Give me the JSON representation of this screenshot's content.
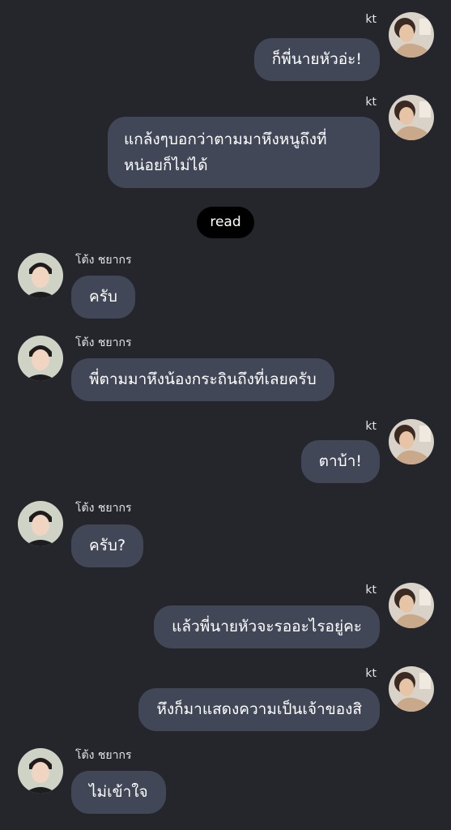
{
  "theme": {
    "background": "#24262c",
    "bubble": "#414756",
    "bubble_text": "#ffffff",
    "read_pill": "#000000"
  },
  "read_receipt": "read",
  "messages": [
    {
      "id": 1,
      "sender": "kt",
      "side": "right",
      "avatar_icon": "kt-avatar-icon",
      "text": "ก็พี่นายหัวอ่ะ!"
    },
    {
      "id": 2,
      "sender": "kt",
      "side": "right",
      "avatar_icon": "kt-avatar-icon",
      "text": "แกล้งๆบอกว่าตามมาหึงหนูถึงที่หน่อยก็ไม่ได้"
    },
    {
      "id": 3,
      "sender": "โต้ง ชยากร",
      "side": "left",
      "avatar_icon": "tong-avatar-icon",
      "text": "ครับ"
    },
    {
      "id": 4,
      "sender": "โต้ง ชยากร",
      "side": "left",
      "avatar_icon": "tong-avatar-icon",
      "text": "พี่ตามมาหึงน้องกระถินถึงที่เลยครับ"
    },
    {
      "id": 5,
      "sender": "kt",
      "side": "right",
      "avatar_icon": "kt-avatar-icon",
      "text": "ตาบ้า!"
    },
    {
      "id": 6,
      "sender": "โต้ง ชยากร",
      "side": "left",
      "avatar_icon": "tong-avatar-icon",
      "text": "ครับ?"
    },
    {
      "id": 7,
      "sender": "kt",
      "side": "right",
      "avatar_icon": "kt-avatar-icon",
      "text": "แล้วพี่นายหัวจะรออะไรอยู่คะ"
    },
    {
      "id": 8,
      "sender": "kt",
      "side": "right",
      "avatar_icon": "kt-avatar-icon",
      "text": "หึงก็มาแสดงความเป็นเจ้าของสิ"
    },
    {
      "id": 9,
      "sender": "โต้ง ชยากร",
      "side": "left",
      "avatar_icon": "tong-avatar-icon",
      "text": "ไม่เข้าใจ"
    }
  ]
}
